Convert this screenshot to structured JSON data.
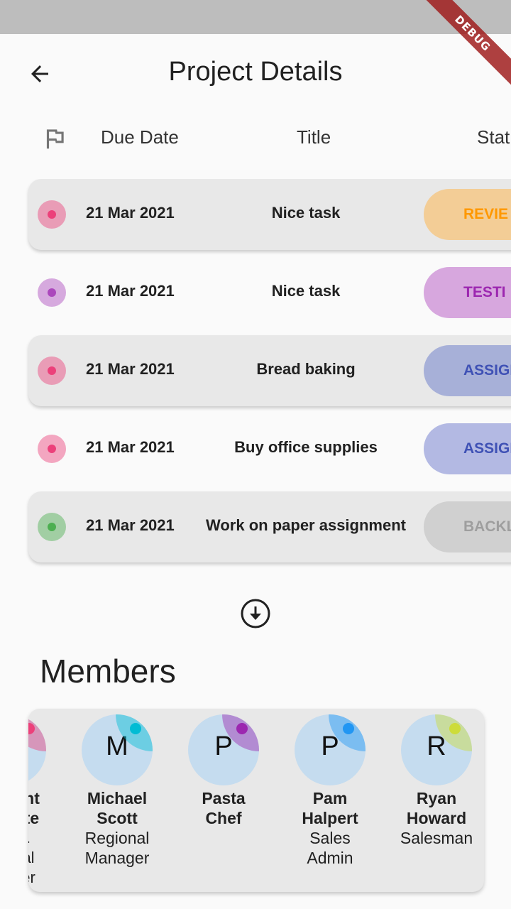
{
  "appbar": {
    "title": "Project Details"
  },
  "debug_banner": "DEBUG",
  "table_header": {
    "due_date": "Due Date",
    "title": "Title",
    "status": "Stat"
  },
  "tasks": [
    {
      "due": "21 Mar 2021",
      "title": "Nice task",
      "status": "REVIE",
      "priority_color": "#ec407a",
      "status_bg": "#f3cd96",
      "status_fg": "#ff9800"
    },
    {
      "due": "21 Mar 2021",
      "title": "Nice task",
      "status": "TESTI",
      "priority_color": "#ab47bc",
      "status_bg": "#d7a7de",
      "status_fg": "#9c27b0"
    },
    {
      "due": "21 Mar 2021",
      "title": "Bread baking",
      "status": "ASSIGI",
      "priority_color": "#ec407a",
      "status_bg": "#a7b0d8",
      "status_fg": "#3f51b5"
    },
    {
      "due": "21 Mar 2021",
      "title": "Buy office supplies",
      "status": "ASSIGI",
      "priority_color": "#ec407a",
      "status_bg": "#b3b9e3",
      "status_fg": "#3f51b5"
    },
    {
      "due": "21 Mar 2021",
      "title": "Work on paper assignment",
      "status": "BACKL",
      "priority_color": "#4caf50",
      "status_bg": "#d0d0d0",
      "status_fg": "#9e9e9e"
    }
  ],
  "members_section": {
    "heading": "Members"
  },
  "members": [
    {
      "initial": "",
      "name": "nt\nte",
      "role": ".\nal\ner",
      "color": "#ec407a"
    },
    {
      "initial": "M",
      "name": "Michael\nScott",
      "role": "Regional\nManager",
      "color": "#00bcd4"
    },
    {
      "initial": "P",
      "name": "Pasta\nChef",
      "role": "",
      "color": "#9c27b0"
    },
    {
      "initial": "P",
      "name": "Pam\nHalpert",
      "role": "Sales\nAdmin",
      "color": "#2196f3"
    },
    {
      "initial": "R",
      "name": "Ryan\nHoward",
      "role": "Salesman",
      "color": "#cddc39"
    }
  ]
}
